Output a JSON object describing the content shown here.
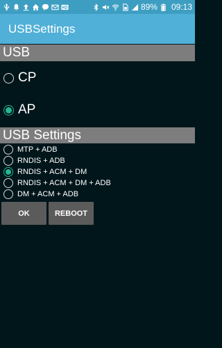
{
  "statusbar": {
    "battery_percent": "89%",
    "time": "09:13",
    "left_icons": [
      "usb-icon",
      "notification-icon",
      "upload-icon",
      "home-icon",
      "chat-icon",
      "mail-icon",
      "hd-icon"
    ],
    "right_icons": [
      "bluetooth-icon",
      "mute-icon",
      "wifi-icon",
      "sim-icon",
      "signal-icon",
      "battery-icon"
    ]
  },
  "app": {
    "title": "USBSettings"
  },
  "usb_section": {
    "header": "USB",
    "options": [
      {
        "label": "CP",
        "checked": false
      },
      {
        "label": "AP",
        "checked": true
      }
    ]
  },
  "settings_section": {
    "header": "USB Settings",
    "options": [
      {
        "label": "MTP + ADB",
        "checked": false
      },
      {
        "label": "RNDIS + ADB",
        "checked": false
      },
      {
        "label": "RNDIS + ACM + DM",
        "checked": true
      },
      {
        "label": "RNDIS + ACM + DM + ADB",
        "checked": false
      },
      {
        "label": "DM + ACM + ADB",
        "checked": false
      }
    ]
  },
  "buttons": {
    "ok": "OK",
    "reboot": "REBOOT"
  },
  "colors": {
    "statusbar": "#3d9ec2",
    "appbar": "#50b0d8",
    "section_header": "#7d7d7d",
    "background": "#01161b",
    "radio_checked": "#27b594",
    "button": "#5b5b5b"
  }
}
